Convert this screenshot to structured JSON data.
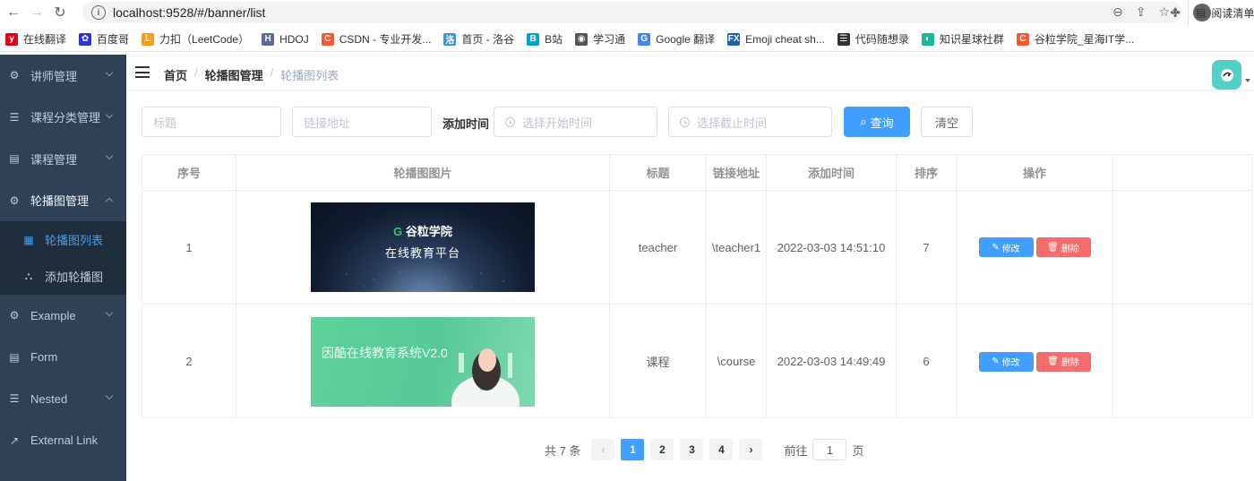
{
  "browser": {
    "url": "localhost:9528/#/banner/list",
    "bookmarks": [
      {
        "label": "在线翻译",
        "icon": "y-icon",
        "color": "#e60012",
        "glyph": "y"
      },
      {
        "label": "百度哥",
        "icon": "baidu-paw-icon",
        "color": "#2932e1",
        "glyph": "✿"
      },
      {
        "label": "力扣（LeetCode）",
        "icon": "leetcode-icon",
        "color": "#f89f1b",
        "glyph": "L"
      },
      {
        "label": "HDOJ",
        "icon": "hdoj-icon",
        "color": "#5a6b9e",
        "glyph": "H"
      },
      {
        "label": "CSDN - 专业开发...",
        "icon": "csdn-icon",
        "color": "#fc5531",
        "glyph": "C"
      },
      {
        "label": "首页 - 洛谷",
        "icon": "luogu-icon",
        "color": "#3498db",
        "glyph": "洛"
      },
      {
        "label": "B站",
        "icon": "bilibili-icon",
        "color": "#00a1d6",
        "glyph": "B"
      },
      {
        "label": "学习通",
        "icon": "globe-icon",
        "color": "#555",
        "glyph": "◉"
      },
      {
        "label": "Google 翻译",
        "icon": "google-translate-icon",
        "color": "#4285f4",
        "glyph": "G"
      },
      {
        "label": "Emoji cheat sh...",
        "icon": "emoji-gift-icon",
        "color": "#1f5fa8",
        "glyph": "FX"
      },
      {
        "label": "代码随想录",
        "icon": "code-icon",
        "color": "#333",
        "glyph": "☰"
      },
      {
        "label": "知识星球社群",
        "icon": "zsxq-icon",
        "color": "#16b998",
        "glyph": "◐"
      },
      {
        "label": "谷粒学院_星海IT学...",
        "icon": "guli-icon",
        "color": "#fc5531",
        "glyph": "C"
      }
    ],
    "more": "»",
    "reading_list": "阅读清单"
  },
  "sidebar": {
    "items": [
      {
        "label": "讲师管理",
        "icon": "gear-icon",
        "expandable": true
      },
      {
        "label": "课程分类管理",
        "icon": "list-icon",
        "expandable": true
      },
      {
        "label": "课程管理",
        "icon": "form-icon",
        "expandable": true
      },
      {
        "label": "轮播图管理",
        "icon": "gear-icon",
        "expandable": true,
        "open": true
      },
      {
        "label": "轮播图列表",
        "icon": "table-icon",
        "sub": true,
        "active": true
      },
      {
        "label": "添加轮播图",
        "icon": "tree-icon",
        "sub": true
      },
      {
        "label": "Example",
        "icon": "gear-icon",
        "expandable": true
      },
      {
        "label": "Form",
        "icon": "form-icon"
      },
      {
        "label": "Nested",
        "icon": "list-icon",
        "expandable": true
      },
      {
        "label": "External Link",
        "icon": "link-icon"
      }
    ]
  },
  "header": {
    "breadcrumb": [
      "首页",
      "轮播图管理",
      "轮播图列表"
    ]
  },
  "search": {
    "title_placeholder": "标题",
    "link_placeholder": "链接地址",
    "add_time_label": "添加时间",
    "start_placeholder": "选择开始时间",
    "end_placeholder": "选择截止时间",
    "query_label": "查询",
    "clear_label": "清空"
  },
  "table": {
    "headers": [
      "序号",
      "轮播图图片",
      "标题",
      "链接地址",
      "添加时间",
      "排序",
      "操作"
    ],
    "rows": [
      {
        "index": "1",
        "image_text": "谷粒学院",
        "image_subtext": "在线教育平台",
        "title": "teacher",
        "link": "\\teacher1",
        "time": "2022-03-03 14:51:10",
        "sort": "7"
      },
      {
        "index": "2",
        "image_text": "因酷在线教育系统V2.0",
        "image_subtext": "",
        "title": "课程",
        "link": "\\course",
        "time": "2022-03-03 14:49:49",
        "sort": "6"
      }
    ],
    "edit_label": "修改",
    "delete_label": "删除"
  },
  "pagination": {
    "total_text": "共 7 条",
    "pages": [
      "1",
      "2",
      "3",
      "4"
    ],
    "current": "1",
    "goto_label": "前往",
    "goto_value": "1",
    "page_suffix": "页"
  },
  "colors": {
    "primary": "#409eff",
    "danger": "#f56c6c",
    "sidebar_bg": "#304156"
  }
}
